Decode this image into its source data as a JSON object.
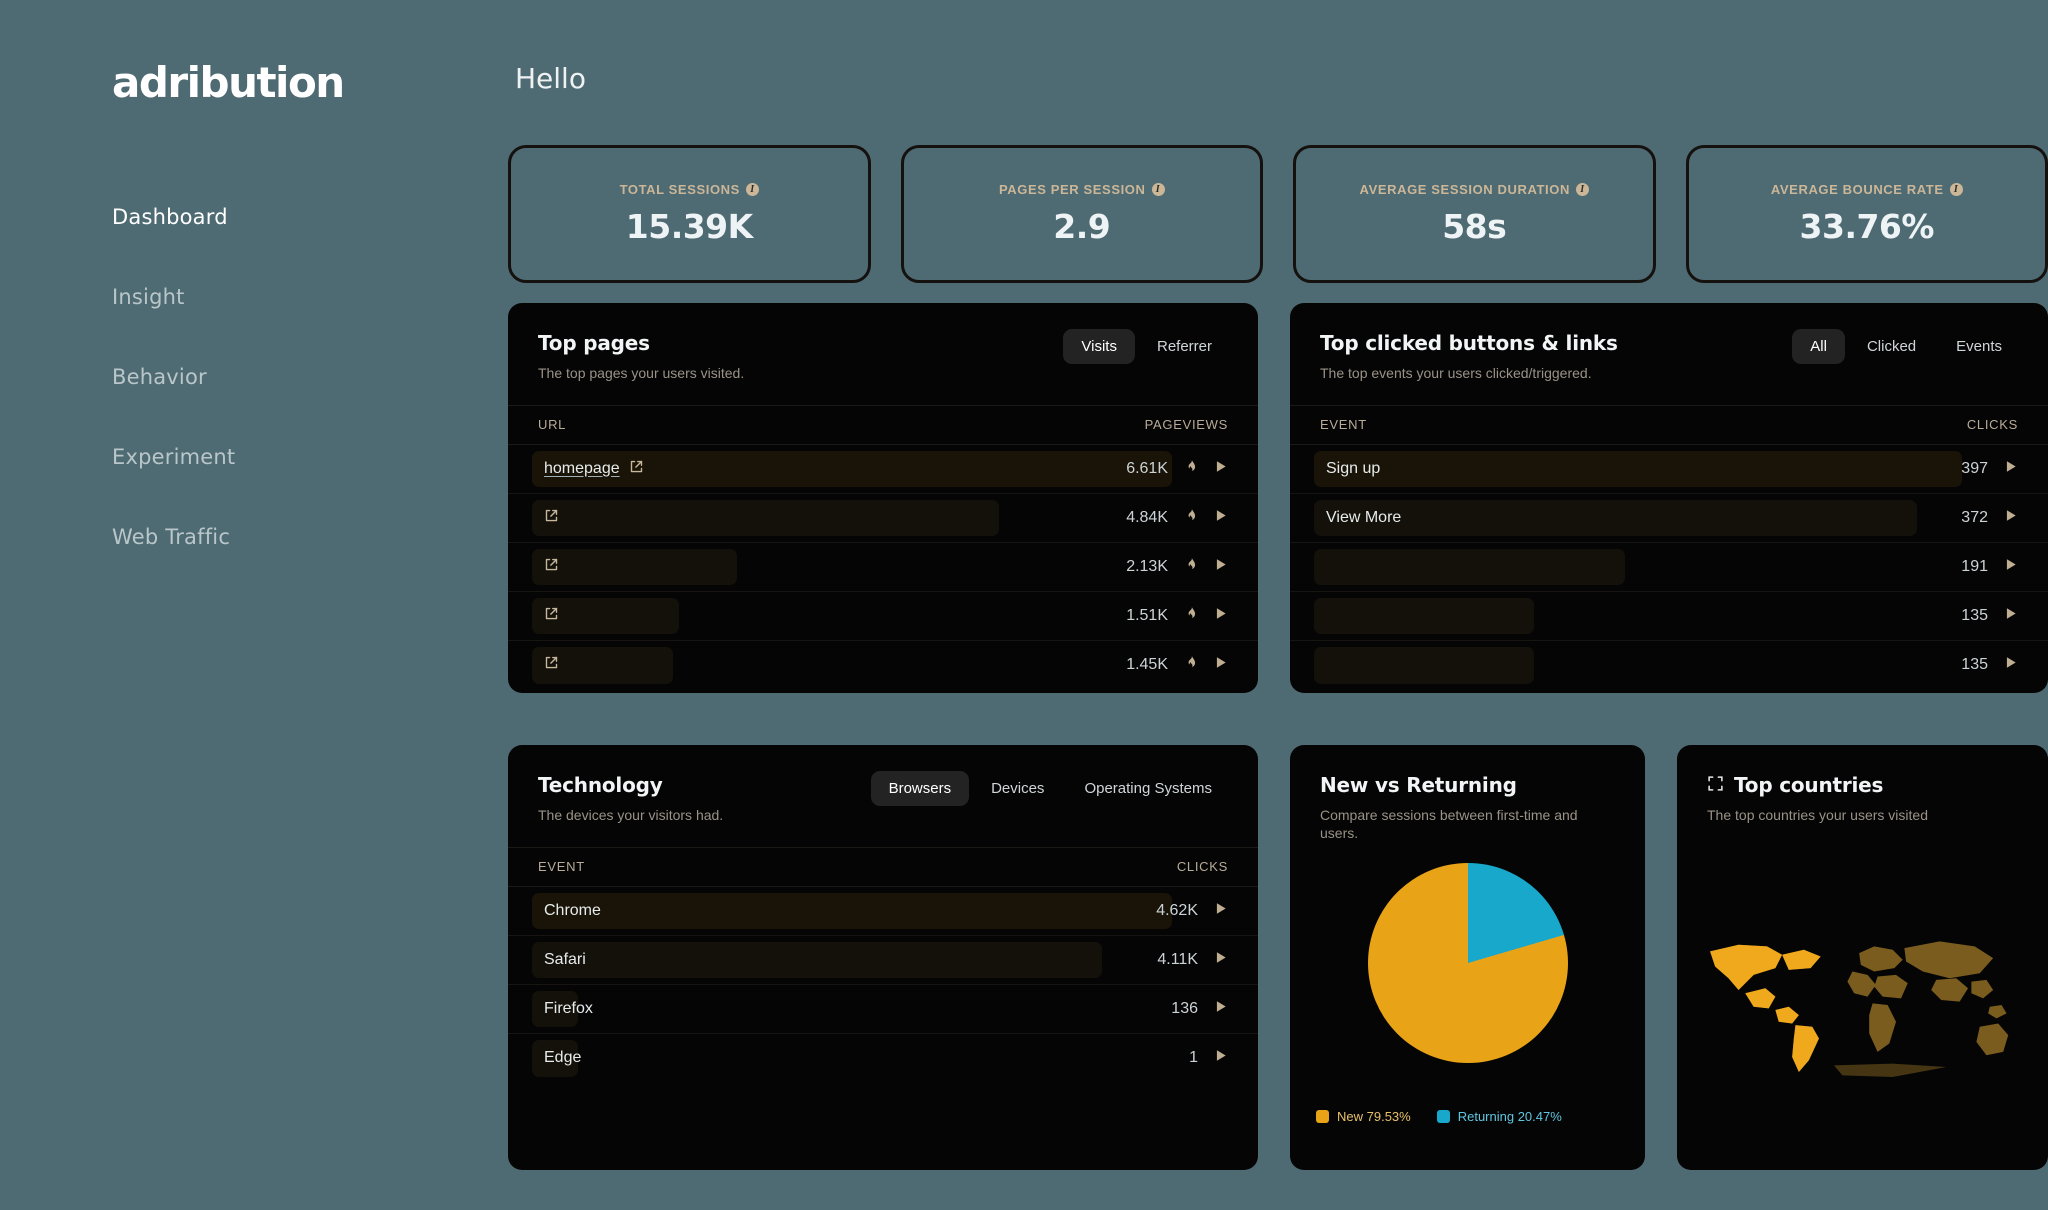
{
  "brand": {
    "logo": "adribution"
  },
  "sidebar": {
    "items": [
      {
        "label": "Dashboard",
        "active": true
      },
      {
        "label": "Insight",
        "active": false
      },
      {
        "label": "Behavior",
        "active": false
      },
      {
        "label": "Experiment",
        "active": false
      },
      {
        "label": "Web Traffic",
        "active": false
      }
    ]
  },
  "header": {
    "greeting": "Hello"
  },
  "kpis": [
    {
      "label": "TOTAL SESSIONS",
      "value": "15.39K",
      "info": "i"
    },
    {
      "label": "PAGES PER SESSION",
      "value": "2.9",
      "info": "i"
    },
    {
      "label": "AVERAGE SESSION DURATION",
      "value": "58s",
      "info": "i"
    },
    {
      "label": "AVERAGE BOUNCE RATE",
      "value": "33.76%",
      "info": "i"
    }
  ],
  "top_pages": {
    "title": "Top pages",
    "subtitle": "The top pages your users visited.",
    "tabs": [
      {
        "label": "Visits",
        "active": true
      },
      {
        "label": "Referrer",
        "active": false
      }
    ],
    "columns": {
      "left": "URL",
      "right": "PAGEVIEWS"
    },
    "rows": [
      {
        "label": "homepage",
        "value": "6.61K",
        "bar_pct": 100
      },
      {
        "label": "",
        "value": "4.84K",
        "bar_pct": 73
      },
      {
        "label": "",
        "value": "2.13K",
        "bar_pct": 32
      },
      {
        "label": "",
        "value": "1.51K",
        "bar_pct": 23
      },
      {
        "label": "",
        "value": "1.45K",
        "bar_pct": 22
      }
    ]
  },
  "top_clicked": {
    "title": "Top clicked buttons & links",
    "subtitle": "The top events your users clicked/triggered.",
    "tabs": [
      {
        "label": "All",
        "active": true
      },
      {
        "label": "Clicked",
        "active": false
      },
      {
        "label": "Events",
        "active": false
      }
    ],
    "columns": {
      "left": "EVENT",
      "right": "CLICKS"
    },
    "rows": [
      {
        "label": "Sign up",
        "value": "397",
        "bar_pct": 100
      },
      {
        "label": "View More",
        "value": "372",
        "bar_pct": 93
      },
      {
        "label": "",
        "value": "191",
        "bar_pct": 48
      },
      {
        "label": "",
        "value": "135",
        "bar_pct": 34
      },
      {
        "label": "",
        "value": "135",
        "bar_pct": 34
      }
    ]
  },
  "technology": {
    "title": "Technology",
    "subtitle": "The devices your visitors had.",
    "tabs": [
      {
        "label": "Browsers",
        "active": true
      },
      {
        "label": "Devices",
        "active": false
      },
      {
        "label": "Operating Systems",
        "active": false
      }
    ],
    "columns": {
      "left": "EVENT",
      "right": "CLICKS"
    },
    "rows": [
      {
        "label": "Chrome",
        "value": "4.62K",
        "bar_pct": 100
      },
      {
        "label": "Safari",
        "value": "4.11K",
        "bar_pct": 89
      },
      {
        "label": "Firefox",
        "value": "136",
        "bar_pct": 3
      },
      {
        "label": "Edge",
        "value": "1",
        "bar_pct": 1
      }
    ]
  },
  "new_vs_returning": {
    "title": "New vs Returning",
    "subtitle": "Compare sessions between first-time and users.",
    "legend": [
      {
        "label": "New 79.53%",
        "color": "#e8a317"
      },
      {
        "label": "Returning 20.47%",
        "color": "#17a8cc"
      }
    ]
  },
  "top_countries": {
    "title": "Top countries",
    "subtitle": "The top countries your users visited",
    "icon": "expand-icon"
  },
  "chart_data": {
    "type": "pie",
    "title": "New vs Returning",
    "labels": [
      "New",
      "Returning"
    ],
    "values": [
      79.53,
      20.47
    ],
    "colors": [
      "#e8a317",
      "#17a8cc"
    ],
    "legend_position": "bottom-left",
    "unit": "%"
  }
}
